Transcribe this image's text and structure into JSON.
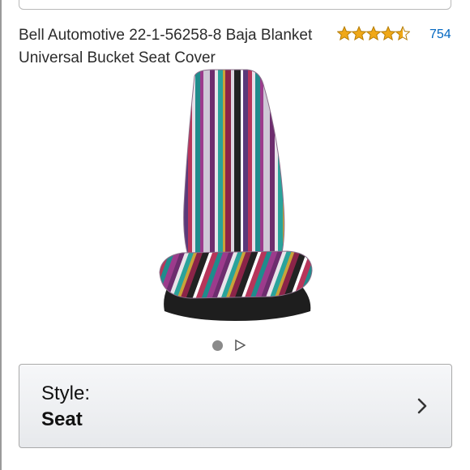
{
  "product": {
    "title": "Bell Automotive 22-1-56258-8 Baja Blanket Universal Bucket Seat Cover",
    "rating": 4.5,
    "rating_max": 5,
    "review_count": "754",
    "image_icon": "striped-seat-cover-image"
  },
  "gallery": {
    "current_index": 1,
    "total_shown_dots": 1
  },
  "style_selector": {
    "label": "Style:",
    "value": "Seat",
    "icon": "chevron-right-icon"
  },
  "colors": {
    "link": "#0066c0",
    "star": "#f0a817"
  }
}
